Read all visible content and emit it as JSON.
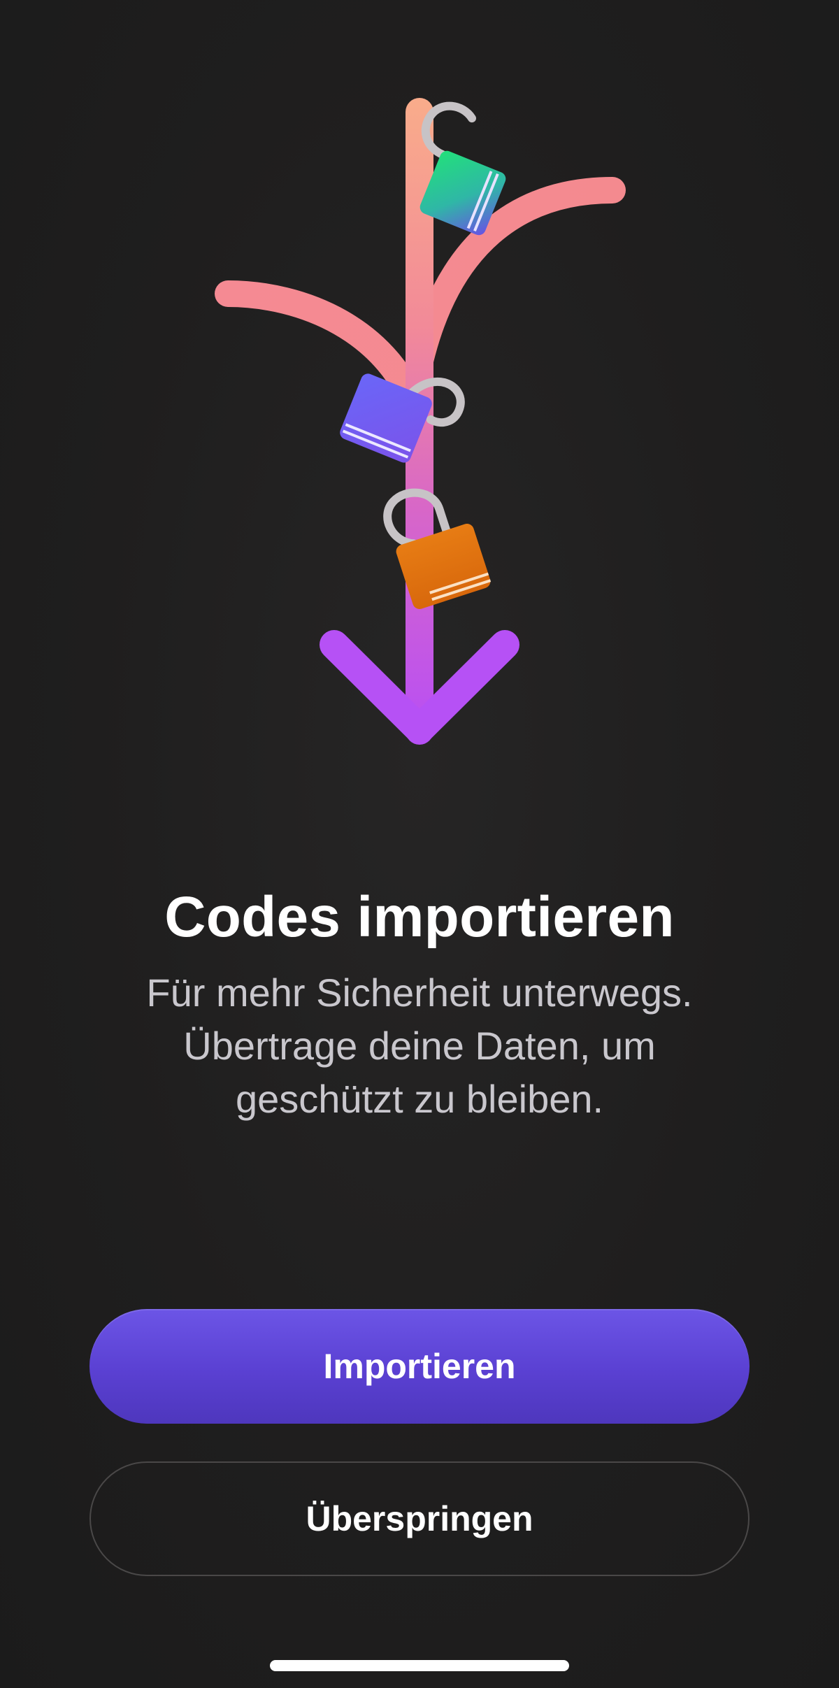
{
  "onboarding": {
    "title": "Codes importieren",
    "subtitle_lines": [
      "Für mehr Sicherheit unterwegs.",
      "Übertrage deine Daten, um",
      "geschützt zu bleiben."
    ],
    "primary_button": "Importieren",
    "secondary_button": "Überspringen"
  },
  "illustration": {
    "icons": [
      "padlock-green-icon",
      "padlock-blue-icon",
      "padlock-orange-icon",
      "arrow-down-icon"
    ]
  },
  "colors": {
    "background": "#1f1e1e",
    "accent": "#5a40d2",
    "stem_top": "#f7a58c",
    "stem_bottom": "#b64ef2",
    "lock_green": "#1fd481",
    "lock_blue": "#6a5ef5",
    "lock_orange": "#e0730f",
    "text_primary": "#ffffff",
    "text_secondary": "#c9c7cd"
  }
}
